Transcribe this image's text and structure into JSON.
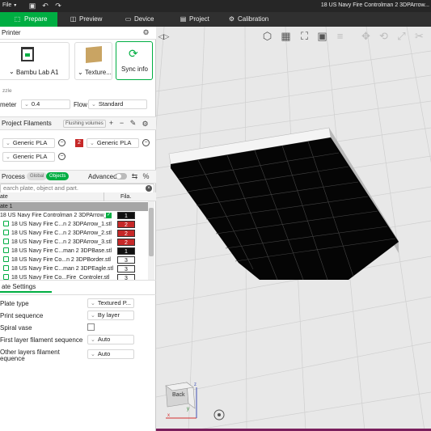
{
  "titlebar": {
    "menu_file": "File",
    "window_title": "18 US Navy Fire Controlman 2 3DPArrow..."
  },
  "tabs": [
    {
      "label": "Prepare",
      "icon": "prepare-icon"
    },
    {
      "label": "Preview",
      "icon": "preview-icon"
    },
    {
      "label": "Device",
      "icon": "device-icon"
    },
    {
      "label": "Project",
      "icon": "project-icon"
    },
    {
      "label": "Calibration",
      "icon": "calibration-icon"
    }
  ],
  "printer": {
    "header": "Printer",
    "printer_name": "Bambu Lab A1",
    "plate_name": "Texture...",
    "sync_label": "Sync info",
    "nozzle_label": "zzle",
    "diameter_label": "meter",
    "diameter_value": "0.4",
    "flow_label": "Flow",
    "flow_value": "Standard"
  },
  "filaments": {
    "header": "Project Filaments",
    "flushing_label": "Flushing volumes",
    "items": [
      {
        "name": "Generic PLA",
        "index": "",
        "color": "#111111"
      },
      {
        "name": "Generic PLA",
        "index": "2",
        "color": "#c62828"
      },
      {
        "name": "Generic PLA",
        "index": "",
        "color": "#ffffff"
      }
    ]
  },
  "process": {
    "header": "Process",
    "global_label": "Global",
    "objects_label": "Objects",
    "advanced_label": "Advanced",
    "search_placeholder": "earch plate, object and part."
  },
  "object_list": {
    "col_name": "ate",
    "col_fila": "Fila.",
    "plate_label": "ate 1",
    "rows": [
      {
        "name": "18 US Navy Fire Controlman 2 3DPArrow_1",
        "fila": "1",
        "color": "c1",
        "checked": true,
        "indent": 0
      },
      {
        "name": "18 US Navy Fire C...n 2 3DPArrow_1.stl",
        "fila": "2",
        "color": "c2",
        "indent": 1
      },
      {
        "name": "18 US Navy Fire C...n 2 3DPArrow_2.stl",
        "fila": "2",
        "color": "c2",
        "indent": 1
      },
      {
        "name": "18 US Navy Fire C...n 2 3DPArrow_3.stl",
        "fila": "2",
        "color": "c2",
        "indent": 1
      },
      {
        "name": "18 US Navy Fire C...man 2 3DPBase.stl",
        "fila": "1",
        "color": "c1",
        "indent": 1
      },
      {
        "name": "18 US Navy Fire Co...n 2 3DPBorder.stl",
        "fila": "3",
        "color": "c3",
        "indent": 1
      },
      {
        "name": "18 US Navy Fire C...man 2 3DPEagle.stl",
        "fila": "3",
        "color": "c3",
        "indent": 1
      },
      {
        "name": "18 US Navy Fire Co...Fire_Controler.stl",
        "fila": "3",
        "color": "c3",
        "indent": 1
      }
    ]
  },
  "plate_settings": {
    "header": "ate Settings",
    "plate_type_label": "Plate type",
    "plate_type_value": "Textured P...",
    "print_sequence_label": "Print sequence",
    "print_sequence_value": "By layer",
    "spiral_label": "Spiral vase",
    "first_layer_label": "First layer filament sequence",
    "first_layer_value": "Auto",
    "other_layers_label_1": "Other layers filament",
    "other_layers_label_2": "equence",
    "other_layers_value": "Auto"
  },
  "view": {
    "cube_label": "Back",
    "axis_x": "x",
    "axis_y": "y",
    "axis_z": "z",
    "toolbar_icons": [
      "add-cube-icon",
      "arrange-grid-icon",
      "orient-icon",
      "plate-icon",
      "layers-icon",
      "move-icon",
      "rotate-icon",
      "scale-icon",
      "cut-icon"
    ]
  },
  "colors": {
    "accent": "#00ae42",
    "model": "#000000",
    "edge": "#cfcfcf"
  }
}
